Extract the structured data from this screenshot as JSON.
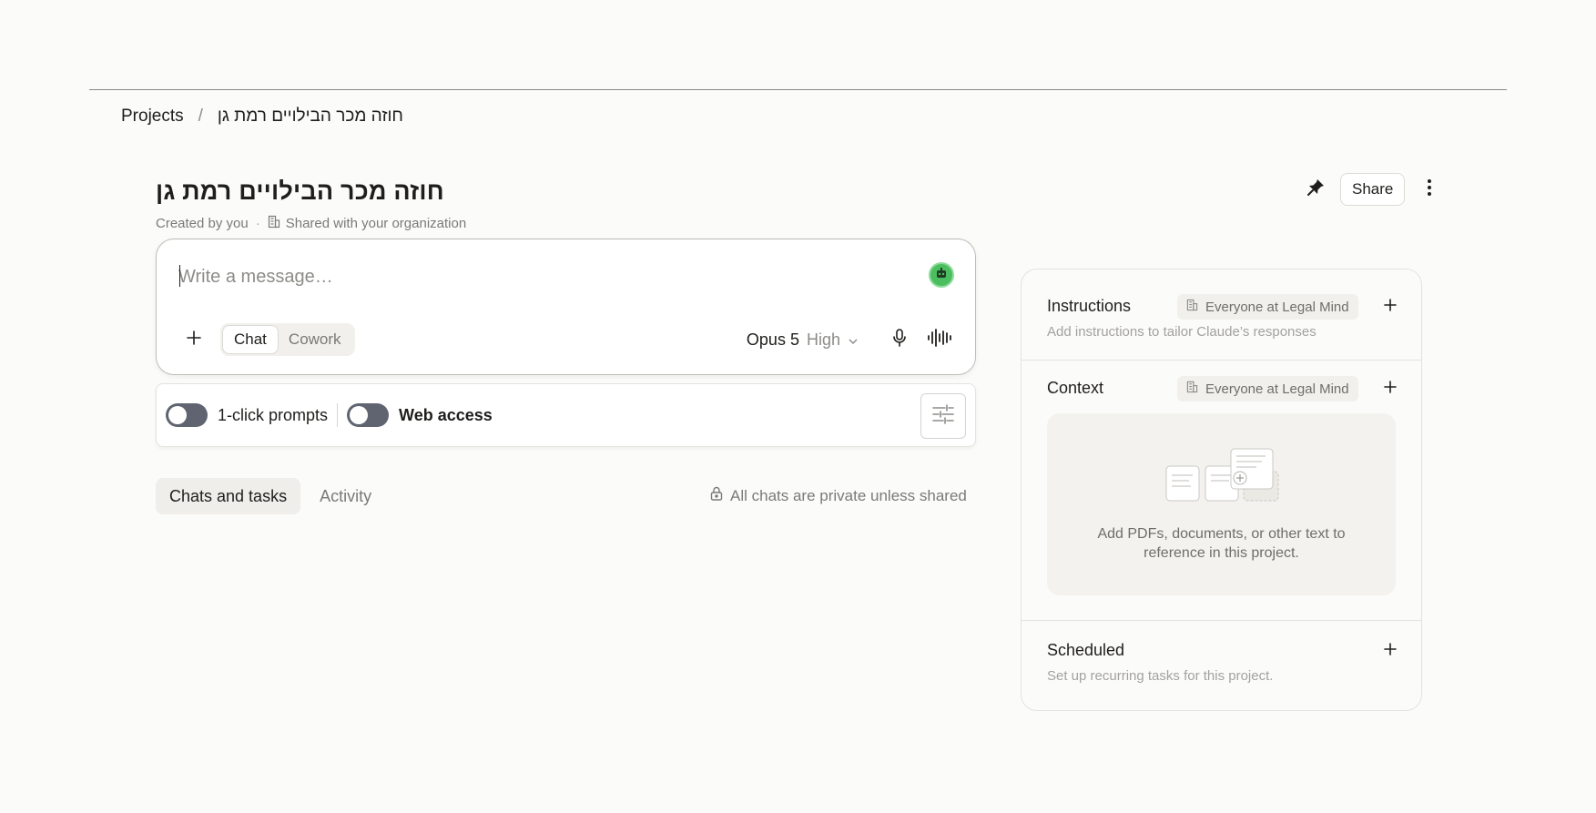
{
  "breadcrumb": {
    "root": "Projects",
    "separator": "/",
    "current": "חוזה מכר הבילויים רמת גן"
  },
  "project": {
    "title": "חוזה מכר הבילויים רמת גן",
    "created_by": "Created by you",
    "meta_separator": "·",
    "sharing": "Shared with your organization"
  },
  "header_actions": {
    "pin_icon": "pin-icon",
    "share_label": "Share",
    "more_icon": "more-vertical-icon"
  },
  "composer": {
    "placeholder": "Write a message…",
    "modes": [
      "Chat",
      "Cowork"
    ],
    "active_mode": "Chat",
    "model": "Opus 5",
    "effort": "High"
  },
  "toggles": {
    "one_click_prompts": {
      "label": "1-click prompts",
      "on": false
    },
    "web_access": {
      "label": "Web access",
      "on": false
    }
  },
  "tabs": {
    "items": [
      "Chats and tasks",
      "Activity"
    ],
    "active": "Chats and tasks"
  },
  "privacy_note": "All chats are private unless shared",
  "side_panel": {
    "instructions": {
      "title": "Instructions",
      "scope": "Everyone at Legal Mind",
      "description": "Add instructions to tailor Claude’s responses"
    },
    "context": {
      "title": "Context",
      "scope": "Everyone at Legal Mind",
      "hint": "Add PDFs, documents, or other text to reference in this project."
    },
    "scheduled": {
      "title": "Scheduled",
      "description": "Set up recurring tasks for this project."
    }
  },
  "colors": {
    "background": "#fbfbf9",
    "toggle_off": "#5f6470",
    "agent_green": "#4bbf5f"
  }
}
